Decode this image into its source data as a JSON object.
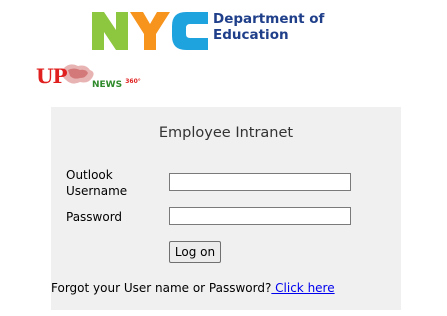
{
  "header": {
    "logo_letters": "NYC",
    "department_line1": "Department of",
    "department_line2": "Education"
  },
  "partner_logo": {
    "brand": "UP",
    "tagline": "NEWS",
    "number": "360°"
  },
  "login": {
    "title": "Employee Intranet",
    "username_label_line1": "Outlook",
    "username_label_line2": "Username",
    "username_value": "",
    "password_label": "Password",
    "password_value": "",
    "logon_button": "Log on",
    "forgot_text": "Forgot your User name or Password?",
    "forgot_link": " Click here"
  },
  "colors": {
    "n_green": "#8dc63f",
    "y_orange": "#f7941d",
    "c_blue": "#1fa3df",
    "doe_navy": "#1f3f8a",
    "panel_bg": "#f0f0f0",
    "link_blue": "#0000ee"
  }
}
